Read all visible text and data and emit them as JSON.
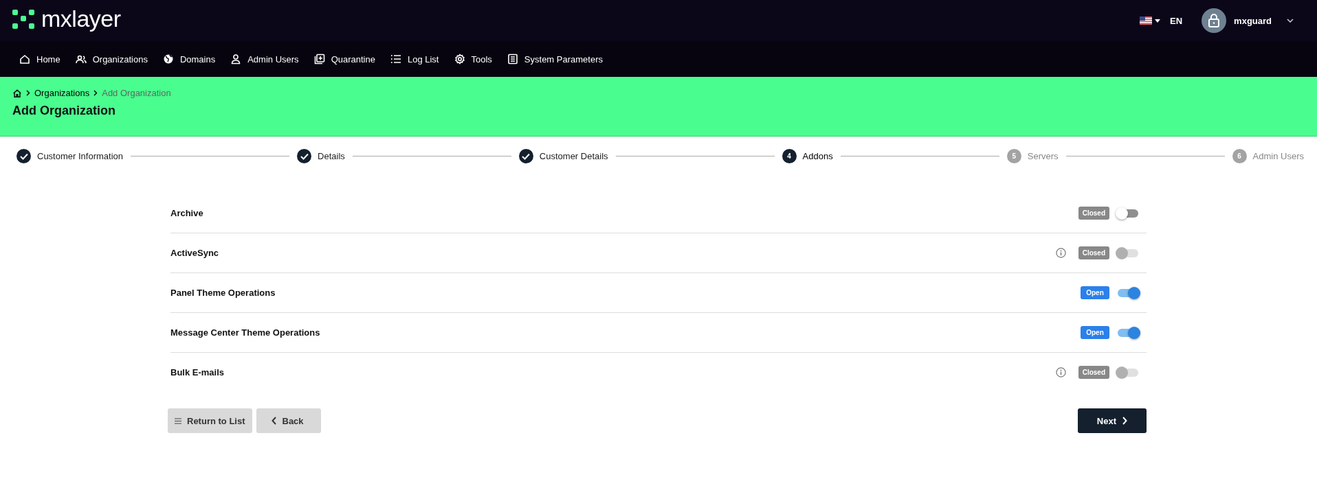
{
  "header": {
    "logo": "mxlayer",
    "language": "EN",
    "user": "mxguard"
  },
  "nav": [
    {
      "label": "Home"
    },
    {
      "label": "Organizations"
    },
    {
      "label": "Domains"
    },
    {
      "label": "Admin Users"
    },
    {
      "label": "Quarantine"
    },
    {
      "label": "Log List"
    },
    {
      "label": "Tools"
    },
    {
      "label": "System Parameters"
    }
  ],
  "breadcrumb": [
    "Organizations",
    "Add Organization"
  ],
  "page_title": "Add Organization",
  "steps": [
    {
      "label": "Customer Information",
      "completed": true,
      "selected": false
    },
    {
      "label": "Details",
      "completed": true,
      "selected": false
    },
    {
      "label": "Customer Details",
      "completed": true,
      "selected": false
    },
    {
      "label": "Addons",
      "number": "4",
      "completed": false,
      "selected": true
    },
    {
      "label": "Servers",
      "number": "5",
      "completed": false,
      "selected": false
    },
    {
      "label": "Admin Users",
      "number": "6",
      "completed": false,
      "selected": false
    }
  ],
  "addons": [
    {
      "name": "Archive",
      "status": "Closed",
      "on": false,
      "disabled": false,
      "info": false
    },
    {
      "name": "ActiveSync",
      "status": "Closed",
      "on": false,
      "disabled": true,
      "info": true
    },
    {
      "name": "Panel Theme Operations",
      "status": "Open",
      "on": true,
      "disabled": false,
      "info": false
    },
    {
      "name": "Message Center Theme Operations",
      "status": "Open",
      "on": true,
      "disabled": false,
      "info": false
    },
    {
      "name": "Bulk E-mails",
      "status": "Closed",
      "on": false,
      "disabled": true,
      "info": true
    }
  ],
  "buttons": {
    "return": "Return to List",
    "back": "Back",
    "next": "Next"
  }
}
